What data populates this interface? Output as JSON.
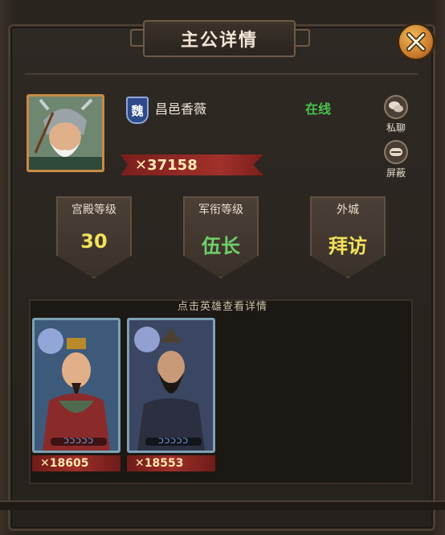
{
  "dialog": {
    "title": "主公详情"
  },
  "player": {
    "kingdom_badge": "魏",
    "name": "昌邑香薇",
    "status": "在线",
    "power": "37158",
    "power_icon": "crossed-swords-icon"
  },
  "side_actions": {
    "private_chat": "私聊",
    "block": "屏蔽"
  },
  "stats": [
    {
      "label": "宫殿等级",
      "value": "30",
      "color": "#f3e25a"
    },
    {
      "label": "军衔等级",
      "value": "伍长",
      "color": "#6fd06a"
    },
    {
      "label": "外城",
      "value": "拜访",
      "color": "#f3e25a"
    }
  ],
  "heroes_section": {
    "hint": "点击英雄查看详情",
    "cards": [
      {
        "power": "18605",
        "stars": "ᑐᑐᑐᑐᑐ"
      },
      {
        "power": "18553",
        "stars": "ᑐᑐᑐᑐᑐ"
      }
    ]
  },
  "colors": {
    "accent_gold": "#c98a45",
    "online_green": "#48c24e",
    "power_red": "#9e2e28"
  }
}
